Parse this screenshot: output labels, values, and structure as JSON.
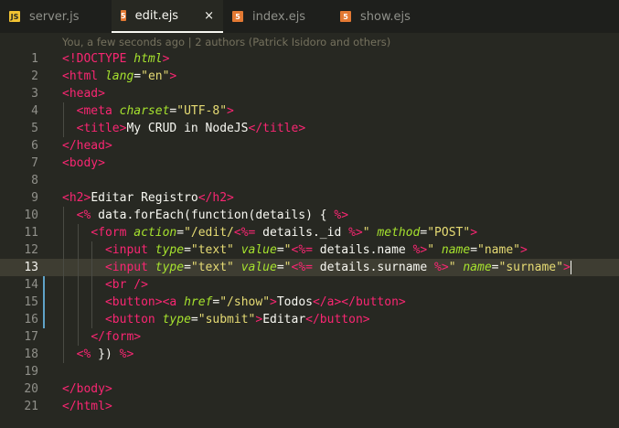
{
  "tabs": [
    {
      "label": "server.js",
      "icon": "js-file-icon",
      "icon_text": "JS",
      "active": false
    },
    {
      "label": "edit.ejs",
      "icon": "html-file-icon",
      "icon_text": "5",
      "active": true,
      "close": "×"
    },
    {
      "label": "index.ejs",
      "icon": "html-file-icon",
      "icon_text": "5",
      "active": false
    },
    {
      "label": "show.ejs",
      "icon": "html-file-icon",
      "icon_text": "5",
      "active": false
    }
  ],
  "blame": "You, a few seconds ago | 2 authors (Patrick Isidoro and others)",
  "current_line": 13,
  "modified_lines": [
    14,
    15,
    16
  ],
  "colors": {
    "tag": "#f92672",
    "attribute": "#a6e22e",
    "string": "#e6db74",
    "background": "#272822"
  },
  "lines": [
    {
      "n": "1",
      "code": "<!DOCTYPE html>"
    },
    {
      "n": "2",
      "code": "<html lang=\"en\">"
    },
    {
      "n": "3",
      "code": "<head>"
    },
    {
      "n": "4",
      "code": "  <meta charset=\"UTF-8\">"
    },
    {
      "n": "5",
      "code": "  <title>My CRUD in NodeJS</title>"
    },
    {
      "n": "6",
      "code": "</head>"
    },
    {
      "n": "7",
      "code": "<body>"
    },
    {
      "n": "8",
      "code": ""
    },
    {
      "n": "9",
      "code": "<h2>Editar Registro</h2>"
    },
    {
      "n": "10",
      "code": "  <% data.forEach(function(details) { %>"
    },
    {
      "n": "11",
      "code": "    <form action=\"/edit/<%= details._id %>\" method=\"POST\">"
    },
    {
      "n": "12",
      "code": "      <input type=\"text\" value=\"<%= details.name %>\" name=\"name\">"
    },
    {
      "n": "13",
      "code": "      <input type=\"text\" value=\"<%= details.surname %>\" name=\"surname\">"
    },
    {
      "n": "14",
      "code": "      <br />"
    },
    {
      "n": "15",
      "code": "      <button><a href=\"/show\">Todos</a></button>"
    },
    {
      "n": "16",
      "code": "      <button type=\"submit\">Editar</button>"
    },
    {
      "n": "17",
      "code": "    </form>"
    },
    {
      "n": "18",
      "code": "  <% }) %>"
    },
    {
      "n": "19",
      "code": ""
    },
    {
      "n": "20",
      "code": "</body>"
    },
    {
      "n": "21",
      "code": "</html>"
    }
  ]
}
